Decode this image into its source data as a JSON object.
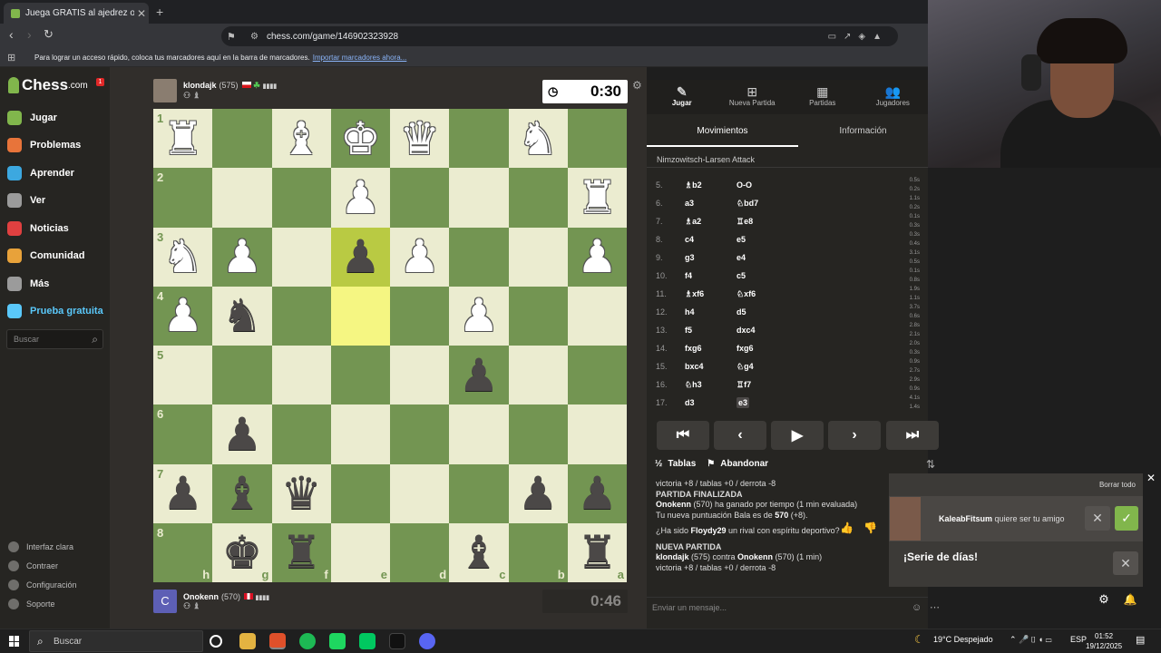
{
  "browser": {
    "tab_title": "Juega GRATIS al ajedrez online -",
    "tab_close": "✕",
    "new_tab": "+",
    "url": "chess.com/game/146902323928",
    "bookmark_prompt": "Para lograr un acceso rápido, coloca tus marcadores aquí en la barra de marcadores.",
    "bookmark_link": "Importar marcadores ahora..."
  },
  "sidebar": {
    "logo": "Chess",
    "logo_suffix": ".com",
    "notif_count": "1",
    "items": [
      {
        "label": "Jugar",
        "color": "#81b64c"
      },
      {
        "label": "Problemas",
        "color": "#e8743a"
      },
      {
        "label": "Aprender",
        "color": "#3ca8e0"
      },
      {
        "label": "Ver",
        "color": "#9b9b9b"
      },
      {
        "label": "Noticias",
        "color": "#e04040"
      },
      {
        "label": "Comunidad",
        "color": "#e8a23a"
      },
      {
        "label": "Más",
        "color": "#9b9b9b"
      },
      {
        "label": "Prueba gratuita",
        "color": "#5ac8fa"
      }
    ],
    "search_placeholder": "Buscar",
    "bottom": [
      "Interfaz clara",
      "Contraer",
      "Configuración",
      "Soporte"
    ]
  },
  "game": {
    "top_player": {
      "name": "klondajk",
      "rating": "(575)",
      "clock": "0:30"
    },
    "bottom_player": {
      "name": "Onokenn",
      "rating": "(570)",
      "clock": "0:46",
      "avatar_letter": "C"
    },
    "board": [
      [
        "wR",
        "",
        "wB",
        "wK",
        "wQ",
        "",
        "wN",
        ""
      ],
      [
        "",
        "",
        "",
        "wP",
        "",
        "",
        "",
        "wR"
      ],
      [
        "wN",
        "wP",
        "",
        "bP",
        "wP",
        "",
        "",
        "wP"
      ],
      [
        "wP",
        "bN",
        "",
        "",
        "",
        "wP",
        "",
        ""
      ],
      [
        "",
        "",
        "",
        "",
        "",
        "bP",
        "",
        ""
      ],
      [
        "",
        "bP",
        "",
        "",
        "",
        "",
        "",
        ""
      ],
      [
        "bP",
        "bB",
        "bQ",
        "",
        "",
        "",
        "bP",
        "bP"
      ],
      [
        "",
        "bK",
        "bR",
        "",
        "",
        "bB",
        "",
        "bR"
      ]
    ],
    "ranks": [
      "1",
      "2",
      "3",
      "4",
      "5",
      "6",
      "7",
      "8"
    ],
    "files": [
      "h",
      "g",
      "f",
      "e",
      "d",
      "c",
      "b",
      "a"
    ]
  },
  "panel": {
    "tabs": [
      {
        "label": "Jugar",
        "icon": "✎"
      },
      {
        "label": "Nueva Partida",
        "icon": "⊞"
      },
      {
        "label": "Partidas",
        "icon": "▦"
      },
      {
        "label": "Jugadores",
        "icon": "👥"
      }
    ],
    "subtabs": [
      "Movimientos",
      "Información"
    ],
    "opening": "Nimzowitsch-Larsen Attack",
    "moves": [
      {
        "n": "5.",
        "w": "♗b2",
        "b": "O-O",
        "tw": "0.5s",
        "tb": "0.2s"
      },
      {
        "n": "6.",
        "w": "a3",
        "b": "♘bd7",
        "tw": "1.1s",
        "tb": "0.2s"
      },
      {
        "n": "7.",
        "w": "♗a2",
        "b": "♖e8",
        "tw": "0.1s",
        "tb": "0.3s"
      },
      {
        "n": "8.",
        "w": "c4",
        "b": "e5",
        "tw": "0.3s",
        "tb": "0.4s"
      },
      {
        "n": "9.",
        "w": "g3",
        "b": "e4",
        "tw": "3.1s",
        "tb": "0.5s"
      },
      {
        "n": "10.",
        "w": "f4",
        "b": "c5",
        "tw": "0.1s",
        "tb": "0.8s"
      },
      {
        "n": "11.",
        "w": "♗xf6",
        "b": "♘xf6",
        "tw": "1.9s",
        "tb": "1.1s"
      },
      {
        "n": "12.",
        "w": "h4",
        "b": "d5",
        "tw": "3.7s",
        "tb": "0.6s"
      },
      {
        "n": "13.",
        "w": "f5",
        "b": "dxc4",
        "tw": "2.8s",
        "tb": "2.1s"
      },
      {
        "n": "14.",
        "w": "fxg6",
        "b": "fxg6",
        "tw": "2.0s",
        "tb": "0.3s"
      },
      {
        "n": "15.",
        "w": "bxc4",
        "b": "♘g4",
        "tw": "0.9s",
        "tb": "2.7s"
      },
      {
        "n": "16.",
        "w": "♘h3",
        "b": "♖f7",
        "tw": "2.9s",
        "tb": "0.9s"
      },
      {
        "n": "17.",
        "w": "d3",
        "b": "e3",
        "tw": "4.1s",
        "tb": "1.4s"
      }
    ],
    "controls": [
      "⏮",
      "‹",
      "▶",
      "›",
      "⏭"
    ],
    "draw": "Tablas",
    "resign": "Abandonar",
    "chat_placeholder": "Enviar un mensaje...",
    "chat": {
      "l1": "victoria +8 / tablas +0 / derrota -8",
      "h1": "PARTIDA FINALIZADA",
      "l2a": "Onokenn",
      "l2b": " (570) ha ganado por tiempo (1 min evaluada)",
      "l3a": "Tu nueva puntuación Bala es de ",
      "l3b": "570",
      "l3c": " (+8).",
      "l4a": "¿Ha sido ",
      "l4b": "Floydy29",
      "l4c": " un rival con espíritu deportivo?",
      "h2": "NUEVA PARTIDA",
      "l5a": "klondajk",
      "l5b": " (575) contra ",
      "l5c": "Onokenn",
      "l5d": " (570) (1 min)",
      "l6": "victoria +8 / tablas +0 / derrota -8"
    }
  },
  "notifications": {
    "clear_all": "Borrar todo",
    "friend_name": "KaleabFitsum",
    "friend_text": " quiere ser tu amigo",
    "streak": "¡Serie de días!"
  },
  "taskbar": {
    "search": "Buscar",
    "weather": "19°C  Despejado",
    "lang": "ESP",
    "time": "01:52",
    "date": "19/12/2025"
  }
}
